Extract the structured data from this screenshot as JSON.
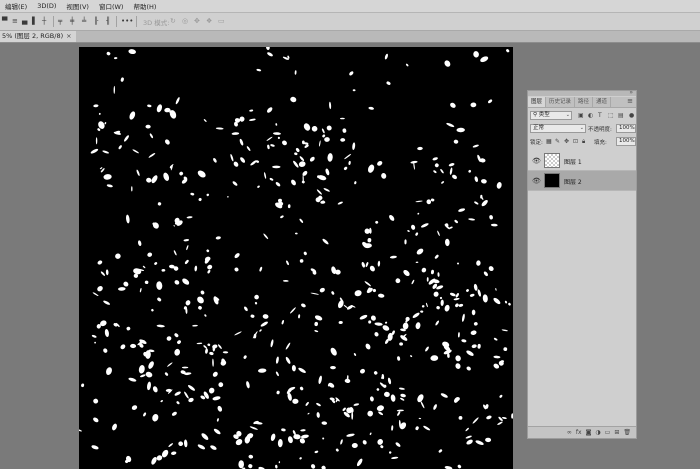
{
  "menubar": {
    "items": [
      "编辑(E)",
      "3D(D)",
      "视图(V)",
      "窗口(W)",
      "帮助(H)"
    ]
  },
  "optionsbar": {
    "mode_label": "3D 模式:",
    "more": "•••"
  },
  "document": {
    "tab_title": "5% (图层 2, RGB/8)",
    "close_glyph": "×"
  },
  "layers_panel": {
    "tabs": [
      "图层",
      "历史记录",
      "路径",
      "通道"
    ],
    "kind_filter": "类型",
    "blend_mode": "正常",
    "opacity_label": "不透明度:",
    "opacity_value": "100%",
    "lock_label": "锁定:",
    "fill_label": "填充:",
    "fill_value": "100%",
    "layers": [
      {
        "name": "图层 1",
        "thumb": "transparent",
        "selected": false
      },
      {
        "name": "图层 2",
        "thumb": "black",
        "selected": true
      }
    ],
    "footer_icons": [
      "link-icon",
      "fx-icon",
      "mask-icon",
      "adjustment-icon",
      "group-icon",
      "new-layer-icon",
      "delete-icon"
    ]
  },
  "colors": {
    "canvas": "#000000",
    "speckle": "#ffffff",
    "workspace": "#7a7a7a",
    "panel": "#cfcfcf",
    "selected_layer": "#a9a9a9"
  }
}
